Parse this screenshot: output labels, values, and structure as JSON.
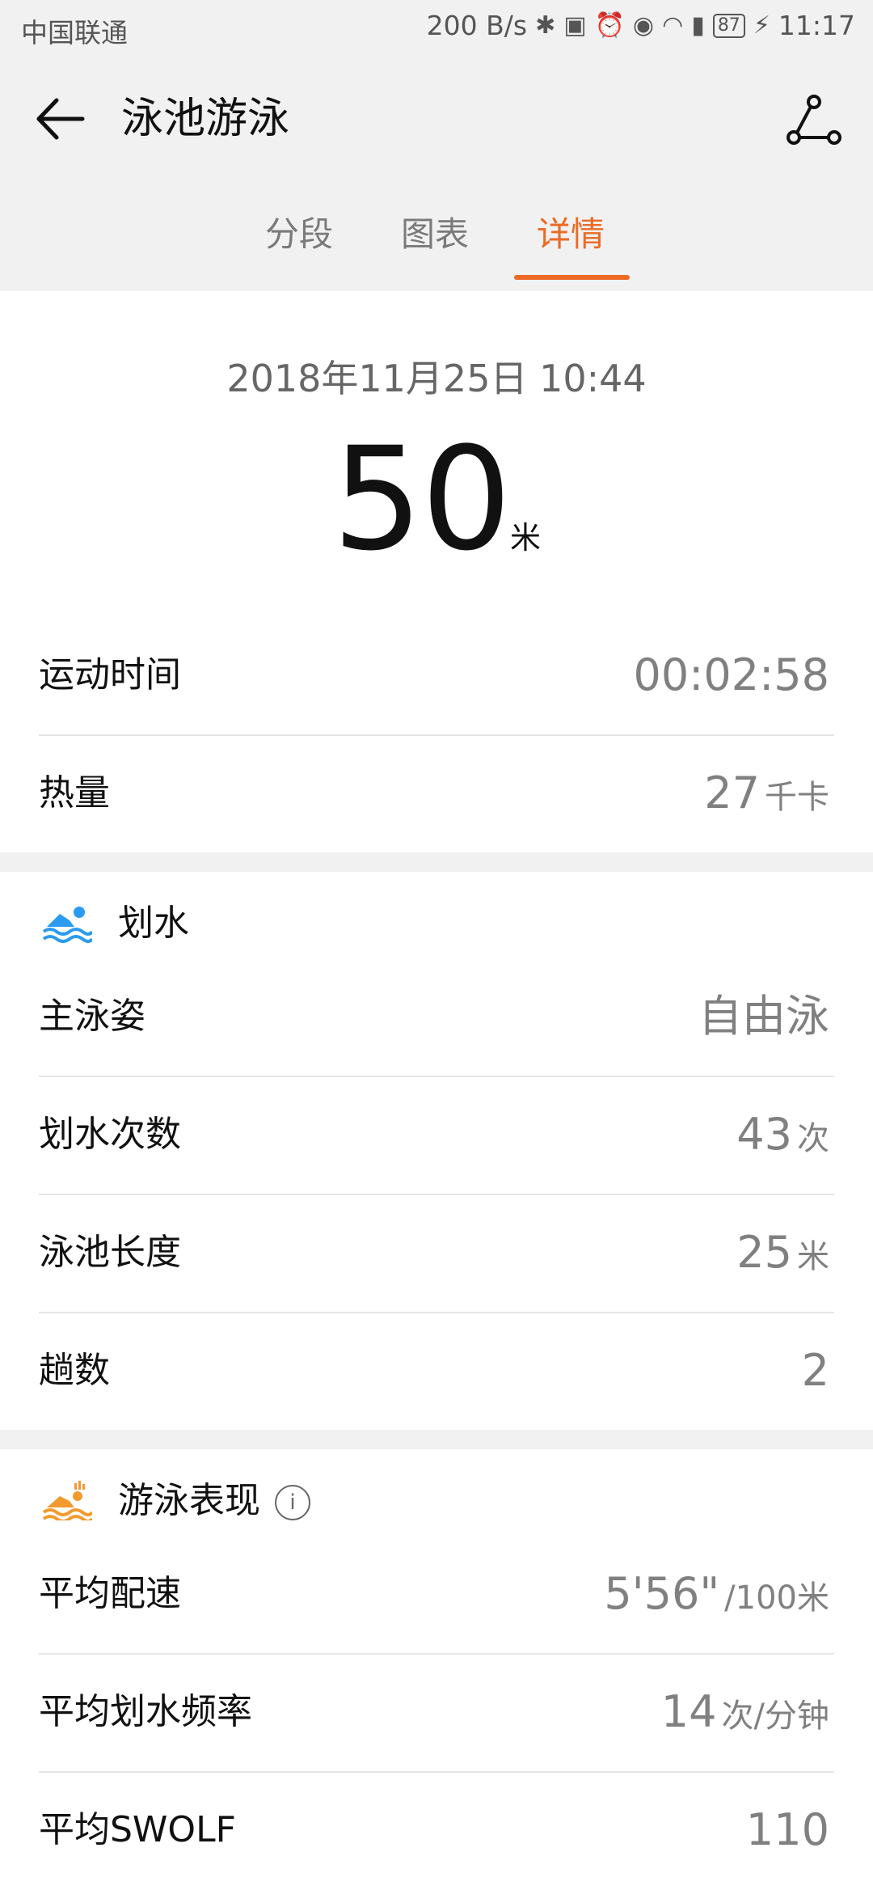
{
  "status_bar": {
    "carrier": "中国联通",
    "net_speed": "200 B/s",
    "battery": "87",
    "time": "11:17"
  },
  "header": {
    "title": "泳池游泳",
    "tabs": [
      "分段",
      "图表",
      "详情"
    ],
    "active_tab": "详情"
  },
  "summary": {
    "datetime": "2018年11月25日 10:44",
    "distance_value": "50",
    "distance_unit": "米",
    "rows": [
      {
        "label": "运动时间",
        "value": "00:02:58",
        "unit": ""
      },
      {
        "label": "热量",
        "value": "27",
        "unit": "千卡"
      }
    ]
  },
  "stroke_section": {
    "title": "划水",
    "rows": [
      {
        "label": "主泳姿",
        "value": "自由泳",
        "unit": ""
      },
      {
        "label": "划水次数",
        "value": "43",
        "unit": "次"
      },
      {
        "label": "泳池长度",
        "value": "25",
        "unit": "米"
      },
      {
        "label": "趟数",
        "value": "2",
        "unit": ""
      }
    ]
  },
  "performance_section": {
    "title": "游泳表现",
    "rows": [
      {
        "label": "平均配速",
        "value": "5'56\"",
        "unit": "/100米"
      },
      {
        "label": "平均划水频率",
        "value": "14",
        "unit": "次/分钟"
      },
      {
        "label": "平均SWOLF",
        "value": "110",
        "unit": ""
      }
    ]
  },
  "colors": {
    "accent": "#ec6a24",
    "swim_icon_blue": "#2a9bf0",
    "swim_icon_orange": "#f29a2e"
  }
}
